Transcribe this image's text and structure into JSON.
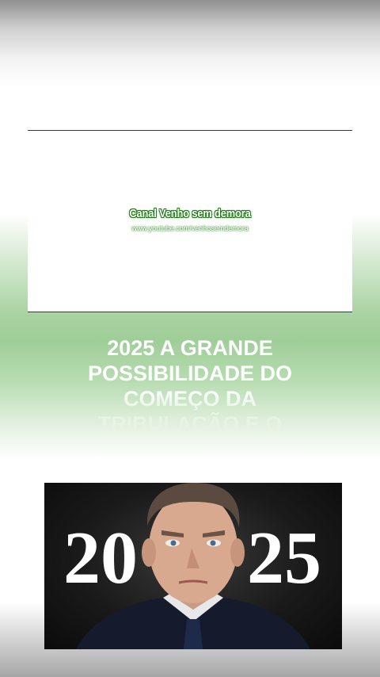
{
  "video": {
    "channel_name": "Canal Venho sem demora",
    "channel_url": "www.youtube.com/venhosemdemora"
  },
  "caption": {
    "lines": [
      "2025 A GRANDE",
      "POSSIBILIDADE DO",
      "COMEÇO DA",
      "TRIBULAÇÃO E O"
    ]
  },
  "thumbnail": {
    "year_left": "20",
    "year_right": "25"
  }
}
